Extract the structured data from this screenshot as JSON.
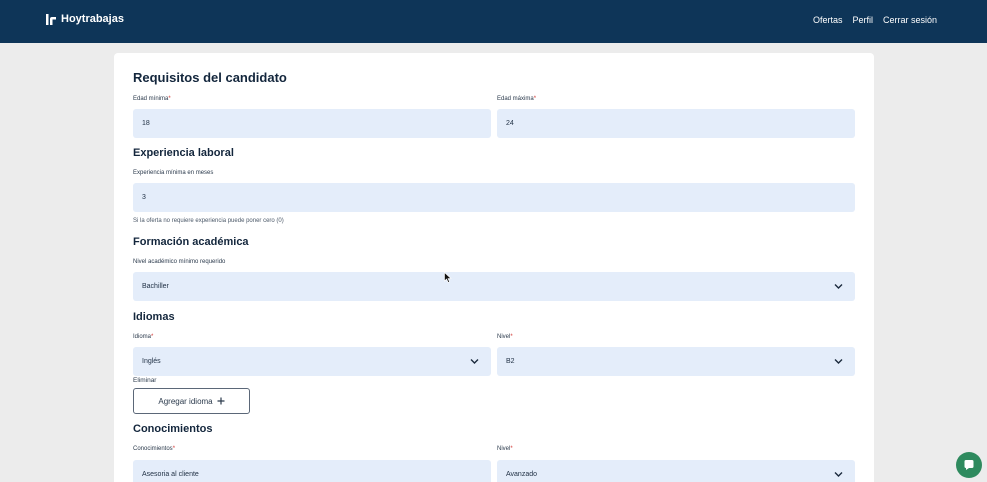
{
  "header": {
    "brand": "Hoytrabajas",
    "nav": [
      "Ofertas",
      "Perfil",
      "Cerrar sesión"
    ]
  },
  "candidate": {
    "title": "Requisitos del candidato",
    "age_min_label": "Edad mínima",
    "age_min_value": "18",
    "age_max_label": "Edad máxima",
    "age_max_value": "24"
  },
  "experience": {
    "title": "Experiencia laboral",
    "label": "Experiencia mínima en meses",
    "value": "3",
    "help": "Si la oferta no requiere experiencia puede poner cero (0)"
  },
  "education": {
    "title": "Formación académica",
    "label": "Nivel académico mínimo requerido",
    "value": "Bachiller"
  },
  "languages": {
    "title": "Idiomas",
    "language_label": "Idioma",
    "language_value": "Inglés",
    "level_label": "Nivel",
    "level_value": "B2",
    "delete": "Eliminar",
    "add_button": "Agregar idioma"
  },
  "knowledge": {
    "title": "Conocimientos",
    "label": "Conocimientos",
    "value": "Asesoria al cliente",
    "level_label": "Nivel",
    "level_value": "Avanzado"
  },
  "required_mark": "*",
  "colors": {
    "header_bg": "#0e3558",
    "field_bg": "#e4edfa",
    "chat_button": "#2e8a5e",
    "required": "#d0312d"
  },
  "icons": {
    "brand": "hoytrabajas-logo-icon",
    "select_arrow": "chevron-down-icon",
    "add": "plus-icon",
    "chat": "chat-bubble-icon",
    "cursor": "mouse-pointer-icon"
  }
}
